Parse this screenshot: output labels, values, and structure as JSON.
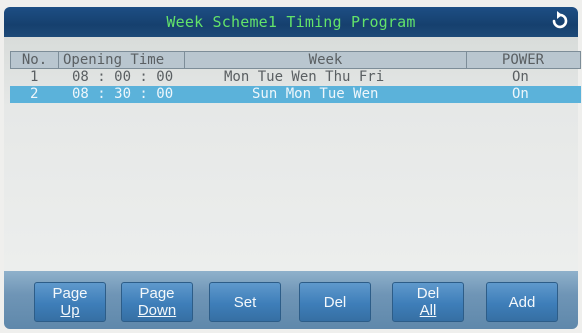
{
  "title": "Week Scheme1 Timing Program",
  "back_icon": "refresh-arrow-icon",
  "table": {
    "headers": [
      "No.",
      "Opening Time",
      "Week",
      "POWER"
    ],
    "rows": [
      {
        "no": "1",
        "time": "08 : 00 : 00",
        "week": "Mon Tue Wen Thu Fri",
        "power": "On",
        "selected": false
      },
      {
        "no": "2",
        "time": "08 : 30 : 00",
        "week": "Sun Mon Tue Wen",
        "power": "On",
        "selected": true
      }
    ]
  },
  "buttons": [
    {
      "line1": "Page",
      "line2": "Up"
    },
    {
      "line1": "Page",
      "line2": "Down"
    },
    {
      "line1": "Set",
      "line2": ""
    },
    {
      "line1": "Del",
      "line2": ""
    },
    {
      "line1": "Del",
      "line2": "All"
    },
    {
      "line1": "Add",
      "line2": ""
    }
  ],
  "colors": {
    "title_text": "#63e36a",
    "title_bar": "#16406e",
    "selected_row": "#5bb2da",
    "button": "#3e7eb9"
  }
}
